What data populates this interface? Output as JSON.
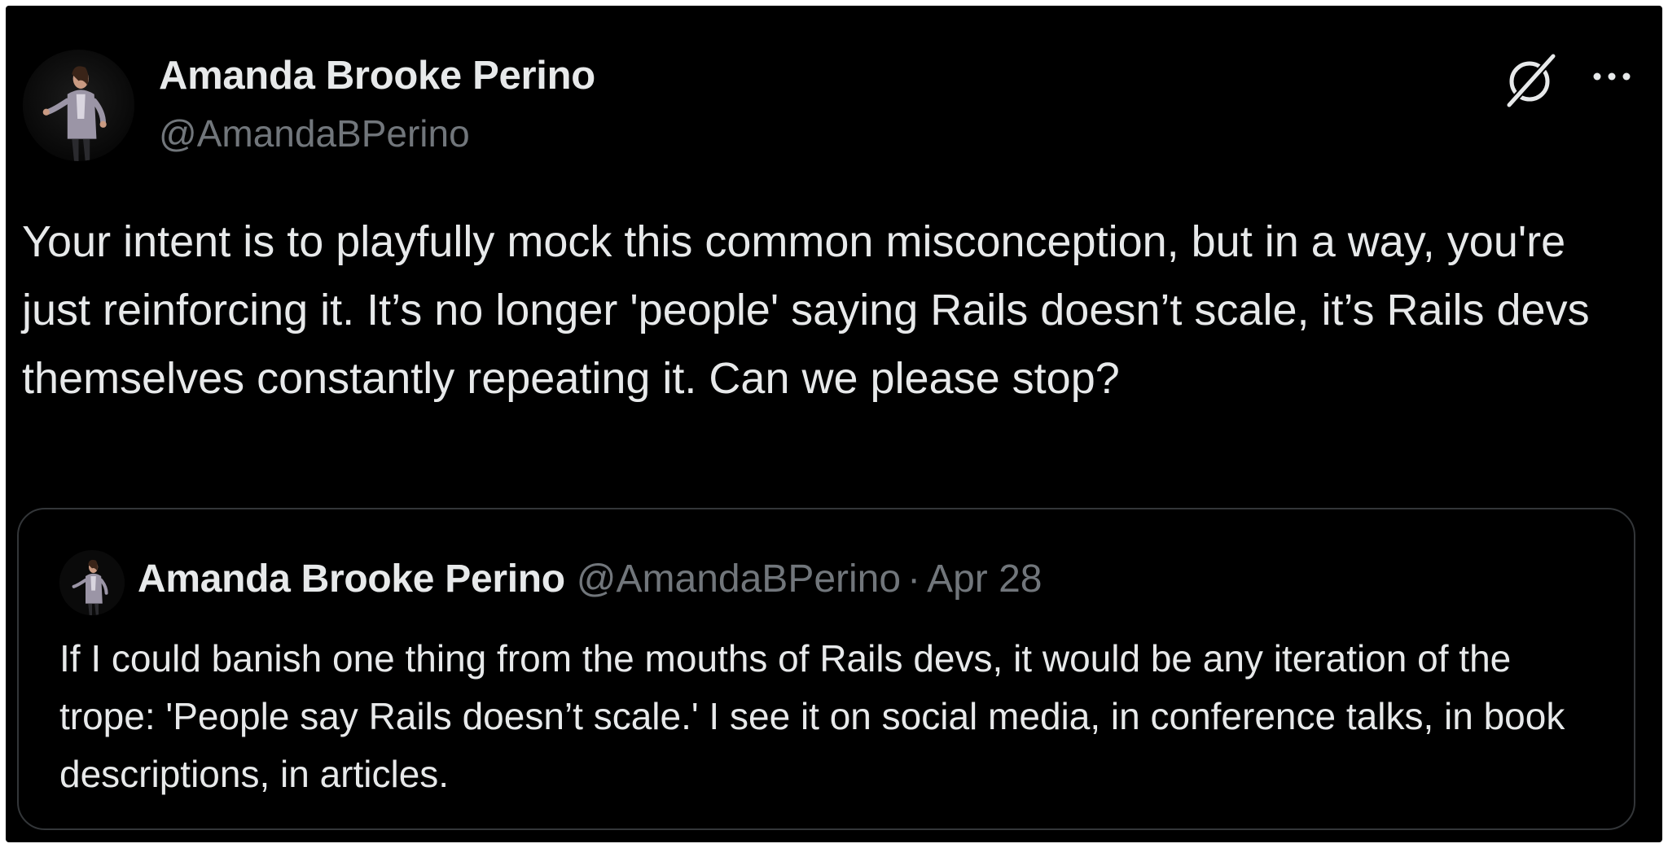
{
  "tweet": {
    "author": {
      "name": "Amanda Brooke Perino",
      "handle": "@AmandaBPerino",
      "avatar_icon": "profile-photo"
    },
    "text": "Your intent is to playfully mock this common misconception, but in a way, you're just reinforcing it. It’s no longer 'people' saying Rails doesn’t scale, it’s Rails devs themselves constantly repeating it. Can we please stop?",
    "actions": {
      "grok_icon": "grok-icon",
      "more_icon": "more-icon"
    }
  },
  "quoted_tweet": {
    "author": {
      "name": "Amanda Brooke Perino",
      "handle": "@AmandaBPerino",
      "avatar_icon": "profile-photo"
    },
    "separator": "·",
    "date": "Apr 28",
    "text": "If I could banish one thing from the mouths of Rails devs, it would be any iteration of the trope: 'People say Rails doesn’t scale.' I see it on social media, in conference talks, in book descriptions, in articles."
  },
  "colors": {
    "background": "#000000",
    "primary_text": "#e7e9ea",
    "secondary_text": "#71767b",
    "border": "#333639"
  }
}
